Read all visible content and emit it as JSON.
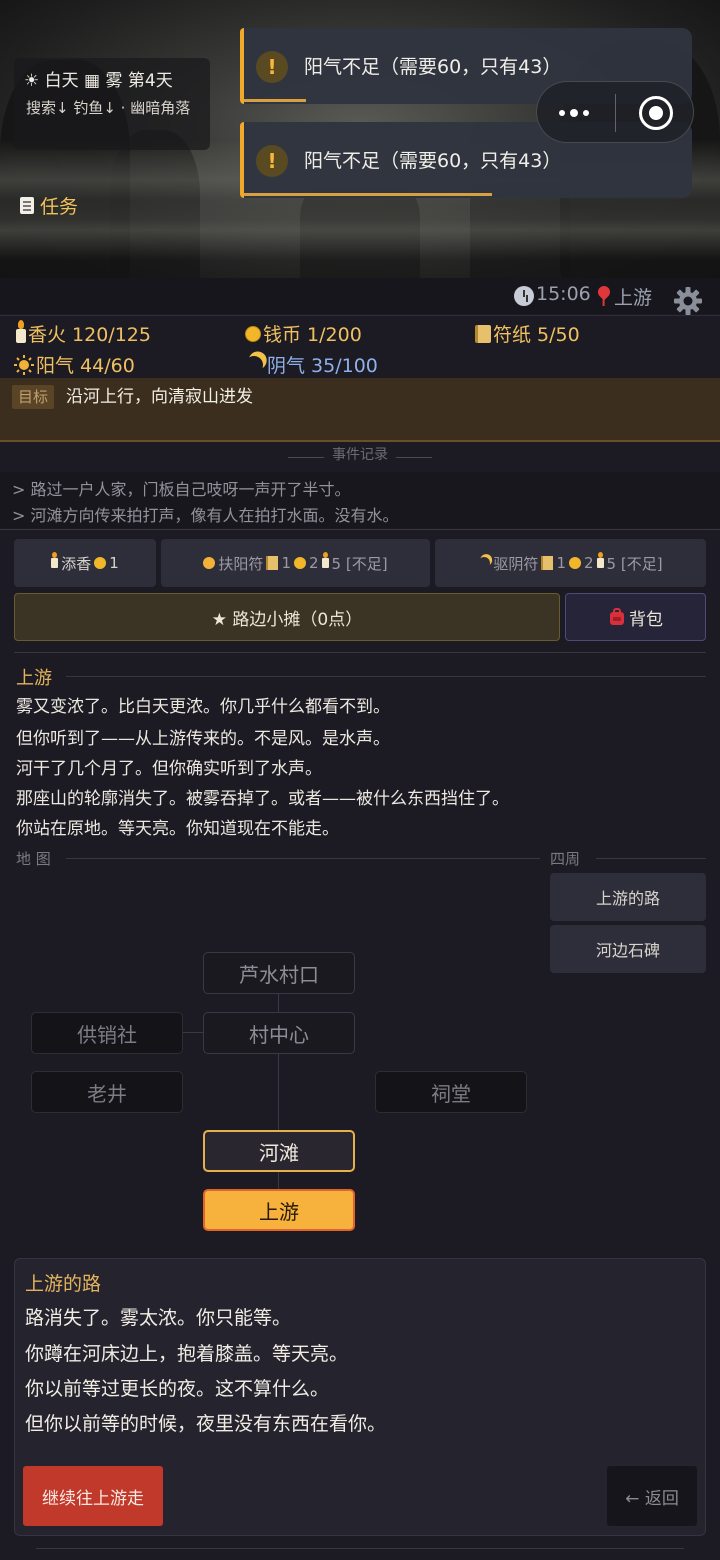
{
  "header": {
    "weather_line": "☀ 白天 ▦ 雾  第4天",
    "status_line": "搜索↓ 钓鱼↓ · 幽暗角落",
    "task_label": "任务"
  },
  "toasts": [
    {
      "text": "阳气不足（需要60，只有43）",
      "progress": 0.15
    },
    {
      "text": "阳气不足（需要60，只有43）",
      "progress": 0.55
    }
  ],
  "topbar": {
    "time": "15:06",
    "location": "上游"
  },
  "resources": {
    "incense": "香火 120/125",
    "coins": "钱币 1/200",
    "talisman": "符纸 5/50",
    "yang": "阳气 44/60",
    "yin": "阴气 35/100"
  },
  "goal": {
    "tag": "目标",
    "text": "沿河上行，向清寂山进发"
  },
  "events": {
    "header": "事件记录",
    "lines": [
      "> 路过一户人家，门板自己吱呀一声开了半寸。",
      "> 河滩方向传来拍打声，像有人在拍打水面。没有水。"
    ]
  },
  "actions": {
    "add_incense": "添香",
    "add_incense_cost": "1",
    "fuyang": "扶阳符",
    "fuyang_c1": "1",
    "fuyang_c2": "2",
    "fuyang_c3": "5 [不足]",
    "quyin": "驱阴符",
    "quyin_c1": "1",
    "quyin_c2": "2",
    "quyin_c3": "5 [不足]",
    "stall": "★ 路边小摊（0点）",
    "bag": "背包"
  },
  "scene": {
    "title": "上游",
    "lines": [
      "雾又变浓了。比白天更浓。你几乎什么都看不到。",
      "但你听到了——从上游传来的。不是风。是水声。",
      "河干了几个月了。但你确实听到了水声。",
      "那座山的轮廓消失了。被雾吞掉了。或者——被什么东西挡住了。",
      "你站在原地。等天亮。你知道现在不能走。"
    ]
  },
  "map": {
    "label": "地 图",
    "surroundings_label": "四周",
    "nodes": {
      "lushui": "芦水村口",
      "gongxiao": "供销社",
      "center": "村中心",
      "well": "老井",
      "shrine": "祠堂",
      "beach": "河滩",
      "upstream": "上游"
    }
  },
  "surroundings": [
    "上游的路",
    "河边石碑"
  ],
  "panel": {
    "title": "上游的路",
    "lines": [
      "路消失了。雾太浓。你只能等。",
      "你蹲在河床边上，抱着膝盖。等天亮。",
      "你以前等过更长的夜。这不算什么。",
      "但你以前等的时候，夜里没有东西在看你。"
    ],
    "continue": "继续往上游走",
    "back": "← 返回"
  },
  "colors": {
    "accent": "#f0a92a",
    "gold_text": "#e4b35c",
    "yin_blue": "#8fb0e8",
    "danger": "#c0392b"
  }
}
